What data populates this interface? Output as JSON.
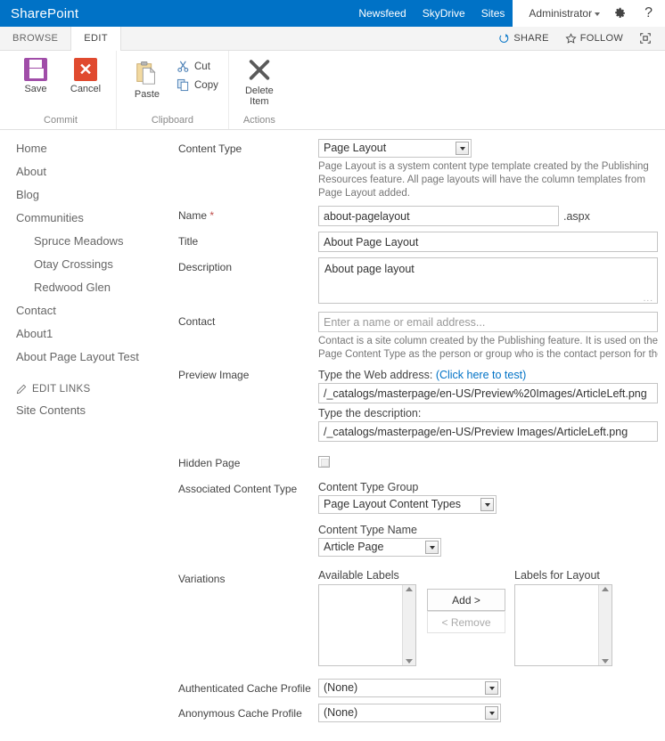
{
  "suite": {
    "brand": "SharePoint",
    "links": [
      {
        "label": "Newsfeed",
        "active": false
      },
      {
        "label": "SkyDrive",
        "active": false
      },
      {
        "label": "Sites",
        "active": true
      }
    ],
    "user": "Administrator",
    "settings_icon": "gear-icon",
    "help_icon": "question-icon",
    "brand_color": "#0072c6"
  },
  "ribbon": {
    "tabs": [
      {
        "label": "BROWSE",
        "active": false
      },
      {
        "label": "EDIT",
        "active": true
      }
    ],
    "actions": [
      {
        "label": "SHARE",
        "icon": "share-icon"
      },
      {
        "label": "FOLLOW",
        "icon": "star-icon"
      },
      {
        "label": "",
        "icon": "focus-on-content-icon"
      }
    ],
    "groups": [
      {
        "name": "Commit",
        "label": "Commit",
        "buttons": [
          {
            "label": "Save",
            "icon": "save-icon",
            "size": "large"
          },
          {
            "label": "Cancel",
            "icon": "cancel-icon",
            "size": "large"
          }
        ]
      },
      {
        "name": "Clipboard",
        "label": "Clipboard",
        "buttons": [
          {
            "label": "Paste",
            "icon": "paste-icon",
            "size": "large"
          },
          {
            "label": "Cut",
            "icon": "scissors-icon",
            "size": "small"
          },
          {
            "label": "Copy",
            "icon": "copy-icon",
            "size": "small"
          }
        ]
      },
      {
        "name": "Actions",
        "label": "Actions",
        "buttons": [
          {
            "label": "Delete Item",
            "label_line1": "Delete",
            "label_line2": "Item",
            "icon": "delete-x-icon",
            "size": "large"
          }
        ]
      }
    ]
  },
  "sidebar": {
    "items": [
      {
        "label": "Home",
        "sub": false
      },
      {
        "label": "About",
        "sub": false
      },
      {
        "label": "Blog",
        "sub": false
      },
      {
        "label": "Communities",
        "sub": false
      },
      {
        "label": "Spruce Meadows",
        "sub": true
      },
      {
        "label": "Otay Crossings",
        "sub": true
      },
      {
        "label": "Redwood Glen",
        "sub": true
      },
      {
        "label": "Contact",
        "sub": false
      },
      {
        "label": "About1",
        "sub": false
      },
      {
        "label": "About Page Layout Test",
        "sub": false
      }
    ],
    "edit_links": "EDIT LINKS",
    "site_contents": "Site Contents"
  },
  "form": {
    "content_type": {
      "label": "Content Type",
      "value": "Page Layout",
      "help_line1": "Page Layout is a system content type template created by the Publishing",
      "help_line2": "Resources feature. All page layouts will have the column templates from",
      "help_line3": "Page Layout added."
    },
    "name": {
      "label": "Name",
      "required_mark": "*",
      "value": "about-pagelayout",
      "suffix": ".aspx"
    },
    "title": {
      "label": "Title",
      "value": "About Page Layout"
    },
    "description": {
      "label": "Description",
      "value": "About page layout",
      "grip": "..."
    },
    "contact": {
      "label": "Contact",
      "placeholder": "Enter a name or email address...",
      "value": "",
      "help_line1": "Contact is a site column created by the Publishing feature. It is used on the",
      "help_line2": "Page Content Type as the person or group who is the contact person for the"
    },
    "preview_image": {
      "label": "Preview Image",
      "web_address_label": "Type the Web address:",
      "test_link": "(Click here to test)",
      "web_address_value": "/_catalogs/masterpage/en-US/Preview%20Images/ArticleLeft.png",
      "description_label": "Type the description:",
      "description_value": "/_catalogs/masterpage/en-US/Preview Images/ArticleLeft.png"
    },
    "hidden_page": {
      "label": "Hidden Page",
      "checked": false
    },
    "associated_content_type": {
      "label": "Associated Content Type",
      "group_label": "Content Type Group",
      "group_value": "Page Layout Content Types",
      "name_label": "Content Type Name",
      "name_value": "Article Page"
    },
    "variations": {
      "label": "Variations",
      "available_header": "Available Labels",
      "available_items": [],
      "layout_header": "Labels for Layout",
      "layout_items": [],
      "add_button": "Add >",
      "remove_button": "< Remove"
    },
    "authenticated_cache_profile": {
      "label": "Authenticated Cache Profile",
      "value": "(None)"
    },
    "anonymous_cache_profile": {
      "label": "Anonymous Cache Profile",
      "value": "(None)"
    }
  }
}
